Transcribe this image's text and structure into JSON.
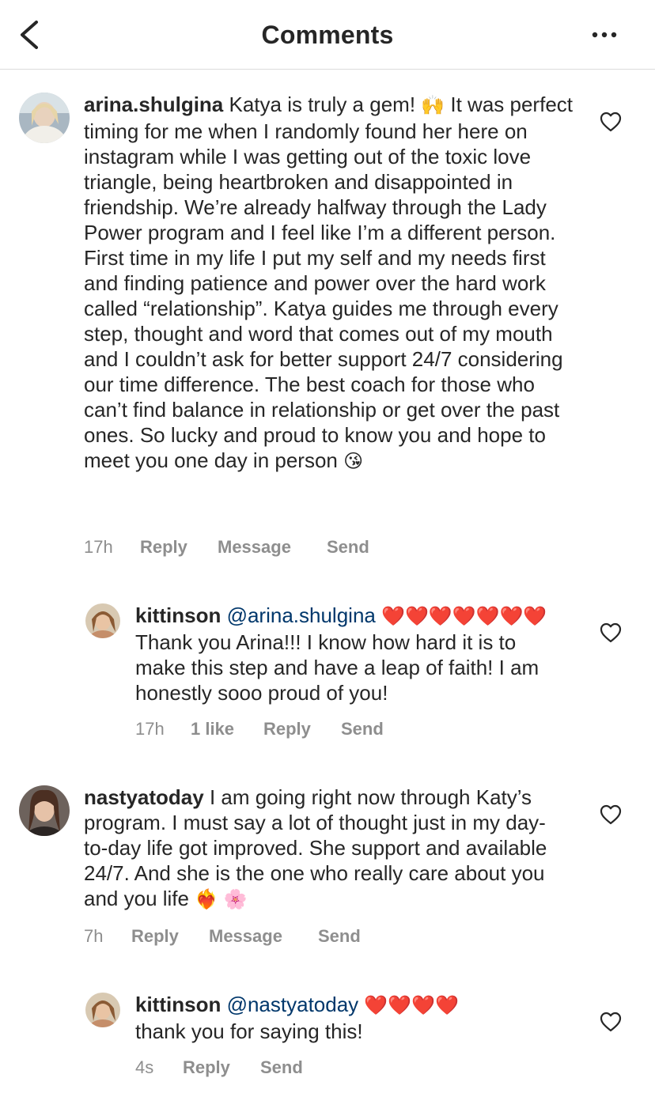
{
  "header": {
    "title": "Comments"
  },
  "comments": [
    {
      "username": "arina.shulgina",
      "text_part1": "Katya is truly a gem! ",
      "emoji1": "🙌",
      "text_part2": " It was perfect timing for me when I randomly found her here on instagram while I was getting out of the toxic love triangle, being heartbroken and disappointed in friendship. We’re already halfway through the Lady Power program and I feel like I’m a different person. First time in my life I put my self and my needs first and finding patience and power over the hard work called “relationship”. Katya guides me through every step, thought and word that comes out of my mouth and I couldn’t ask for better support 24/7 considering our time difference. The best coach for those who can’t find balance in relationship or get over the past ones. So lucky and proud to know you and hope to meet you one day in person ",
      "emoji2": "😘",
      "time": "17h",
      "reply_label": "Reply",
      "message_label": "Message",
      "send_label": "Send"
    },
    {
      "username": "kittinson",
      "mention": "@arina.shulgina",
      "hearts": "❤️❤️❤️❤️❤️❤️❤️",
      "text": " Thank you Arina!!! I know how hard it is to make this step and have a leap of faith!  I am honestly sooo proud of you!",
      "time": "17h",
      "likes": "1 like",
      "reply_label": "Reply",
      "send_label": "Send"
    },
    {
      "username": "nastyatoday",
      "text": "I am going right now through Katy’s program. I must say a lot of thought just in my day-to-day life got improved. She support and available 24/7. And she is the one who really care about you and you life ",
      "emoji": "❤️‍🔥 🌸",
      "time": "7h",
      "reply_label": "Reply",
      "message_label": "Message",
      "send_label": "Send"
    },
    {
      "username": "kittinson",
      "mention": "@nastyatoday",
      "hearts": "❤️❤️❤️❤️",
      "text": "thank you for saying this!",
      "time": "4s",
      "reply_label": "Reply",
      "send_label": "Send"
    }
  ]
}
